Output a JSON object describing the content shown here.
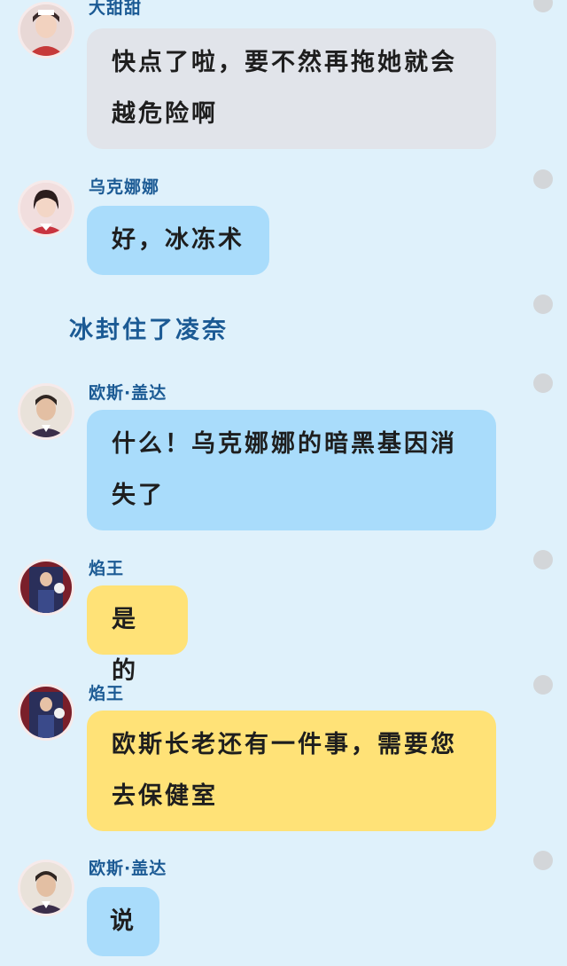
{
  "messages": [
    {
      "speaker": "大甜甜",
      "text": "快点了啦，要不然再拖她就会越危险啊",
      "color": "#e1e4ea"
    },
    {
      "speaker": "乌克娜娜",
      "text": "好，冰冻术",
      "color": "#a9dcfb"
    },
    {
      "speaker": "欧斯·盖达",
      "text": "什么！乌克娜娜的暗黑基因消失了",
      "color": "#a9dcfb"
    },
    {
      "speaker": "焰王",
      "text": "是的",
      "color": "#ffe277"
    },
    {
      "speaker": "焰王",
      "text": "欧斯长老还有一件事，需要您去保健室",
      "color": "#ffe277"
    },
    {
      "speaker": "欧斯·盖达",
      "text": "说",
      "color": "#a9dcfb"
    }
  ],
  "narration": "冰封住了凌奈",
  "icons": {
    "avatar": "avatar-icon",
    "options": "more-options-dot-icon"
  },
  "colors": {
    "background": "#dff1fb",
    "name": "#1b5a94",
    "gray_bubble": "#e1e4ea",
    "blue_bubble": "#a9dcfb",
    "yellow_bubble": "#ffe277"
  }
}
